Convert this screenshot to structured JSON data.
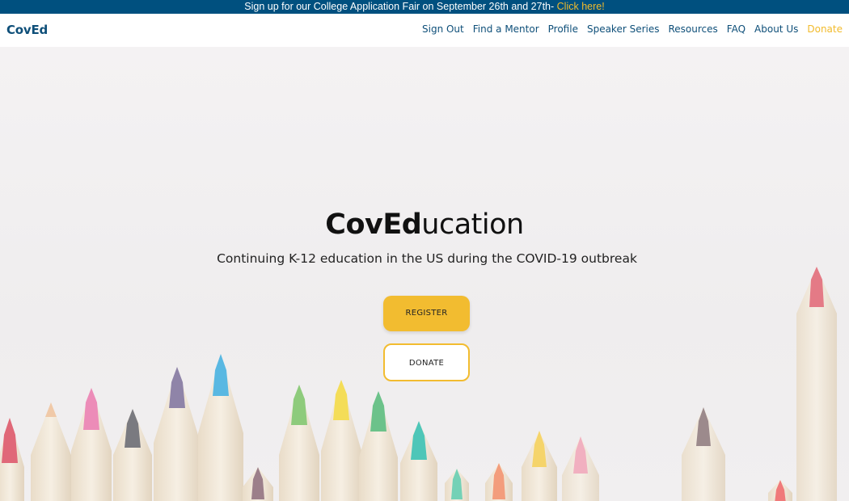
{
  "announcement": {
    "text": "Sign up for our College Application Fair on September 26th and 27th- ",
    "link": "Click here!"
  },
  "nav": {
    "brand": "CovEd",
    "links": [
      "Sign Out",
      "Find a Mentor",
      "Profile",
      "Speaker Series",
      "Resources",
      "FAQ",
      "About Us"
    ],
    "donate": "Donate"
  },
  "hero": {
    "title_bold": "CovEd",
    "title_rest": "ucation",
    "subtitle": "Continuing K-12 education in the US during the COVID-19 outbreak",
    "register_label": "REGISTER",
    "donate_label": "DONATE"
  },
  "colors": {
    "announce_bg": "#00507f",
    "brand_blue": "#0e4f79",
    "accent_yellow": "#f2bc30"
  }
}
